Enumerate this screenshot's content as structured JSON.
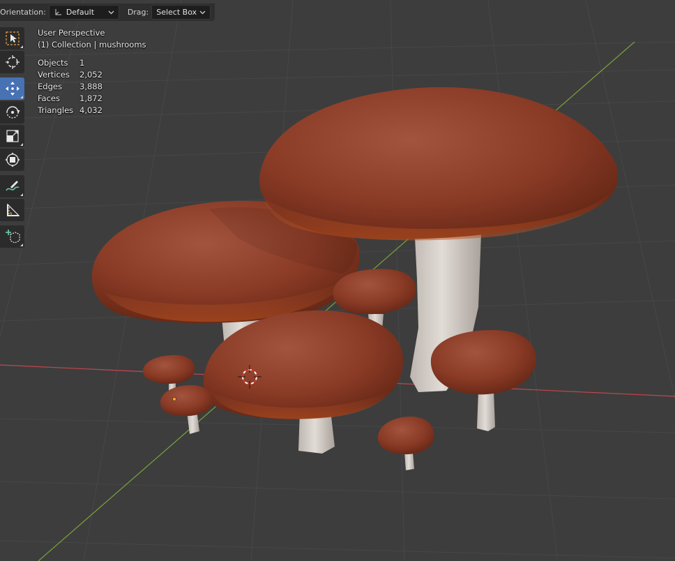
{
  "header": {
    "orientation_label": "Orientation:",
    "orientation_value": "Default",
    "drag_label": "Drag:",
    "drag_value": "Select Box"
  },
  "overlay": {
    "view_name": "User Perspective",
    "collection_line": "(1) Collection | mushrooms",
    "stats": [
      {
        "label": "Objects",
        "value": "1"
      },
      {
        "label": "Vertices",
        "value": "2,052"
      },
      {
        "label": "Edges",
        "value": "3,888"
      },
      {
        "label": "Faces",
        "value": "1,872"
      },
      {
        "label": "Triangles",
        "value": "4,032"
      }
    ]
  },
  "toolbar": {
    "tools": [
      {
        "name": "select-box-tool",
        "icon": "select-box-icon",
        "active": false
      },
      {
        "name": "cursor-tool",
        "icon": "cursor-icon",
        "active": false
      },
      {
        "name": "move-tool",
        "icon": "move-icon",
        "active": true
      },
      {
        "name": "rotate-tool",
        "icon": "rotate-icon",
        "active": false
      },
      {
        "name": "scale-tool",
        "icon": "scale-icon",
        "active": false
      },
      {
        "name": "transform-tool",
        "icon": "transform-icon",
        "active": false
      },
      {
        "name": "annotate-tool",
        "icon": "annotate-icon",
        "active": false
      },
      {
        "name": "measure-tool",
        "icon": "measure-icon",
        "active": false
      },
      {
        "name": "add-cube-tool",
        "icon": "add-cube-icon",
        "active": false
      }
    ]
  },
  "colors": {
    "viewport_bg": "#3d3d3d",
    "active_tool": "#4772b3",
    "x_axis": "#c4464e",
    "y_axis": "#7aa33a",
    "mushroom_cap": "#8a3a24",
    "mushroom_stem": "#d9d4cf"
  }
}
